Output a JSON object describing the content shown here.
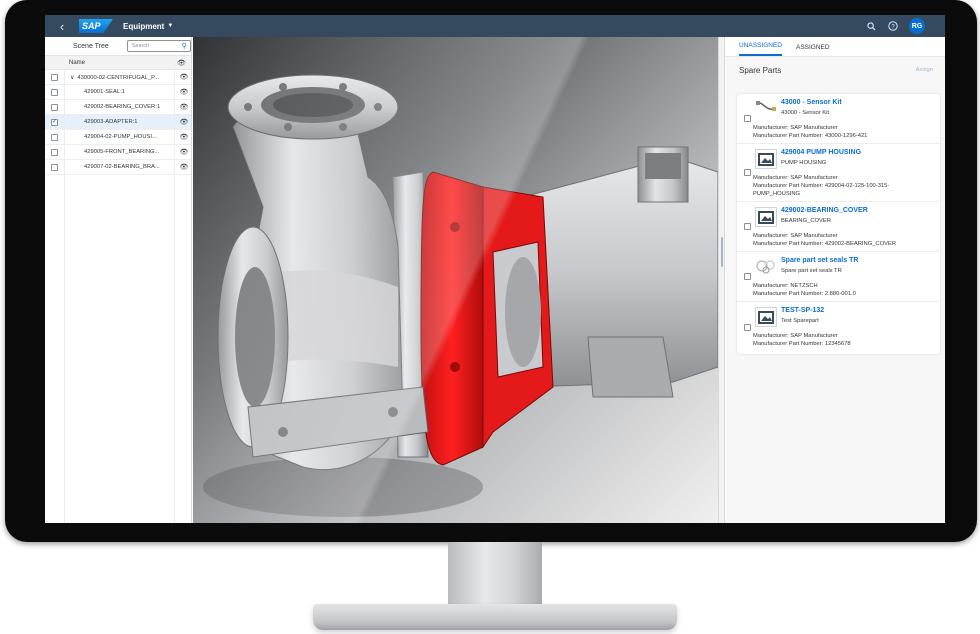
{
  "shell": {
    "back_icon": "chevron-left-icon",
    "logo_text": "SAP",
    "app_title": "Equipment",
    "search_icon": "search-icon",
    "help_icon": "help-icon",
    "avatar_initials": "RG",
    "colors": {
      "shell_bg": "#354a5f",
      "accent": "#0a6ed1",
      "highlight": "#e01b1b"
    }
  },
  "scene_tree": {
    "title": "Scene Tree",
    "search_placeholder": "Search",
    "column_name": "Name",
    "rows": [
      {
        "label": "430000-02-CENTRIFUGAL_P...",
        "checked": false,
        "selected": false,
        "expanded": true,
        "level": 0
      },
      {
        "label": "429001-SEAL:1",
        "checked": false,
        "selected": false,
        "level": 1
      },
      {
        "label": "429002-BEARING_COVER:1",
        "checked": false,
        "selected": false,
        "level": 1
      },
      {
        "label": "429003-ADAPTER:1",
        "checked": true,
        "selected": true,
        "level": 1
      },
      {
        "label": "429004-02-PUMP_HOUSI...",
        "checked": false,
        "selected": false,
        "level": 1
      },
      {
        "label": "429005-FRONT_BEARING...",
        "checked": false,
        "selected": false,
        "level": 1
      },
      {
        "label": "429007-02-BEARING_BRA...",
        "checked": false,
        "selected": false,
        "level": 1
      }
    ]
  },
  "right_panel": {
    "tabs": [
      {
        "label": "UNASSIGNED",
        "active": true
      },
      {
        "label": "ASSIGNED",
        "active": false
      }
    ],
    "section_title": "Spare Parts",
    "assign_label": "Assign",
    "spare_parts": [
      {
        "title": "43000 - Sensor Kit",
        "description": "43000 - Sensor Kit",
        "thumbnail": "cable-icon",
        "meta": [
          "Manufacturer: SAP Manufacturer",
          "Manufacturer Part Number: 43000-1296-421"
        ]
      },
      {
        "title": "429004 PUMP HOUSING",
        "description": "PUMP HOUSING",
        "thumbnail": "image-placeholder-icon",
        "meta": [
          "Manufacturer: SAP Manufacturer",
          "Manufacturer Part Number: 429004-02-125-100-315-",
          "PUMP_HOUSING"
        ]
      },
      {
        "title": "429002-BEARING_COVER",
        "description": "BEARING_COVER",
        "thumbnail": "image-placeholder-icon",
        "meta": [
          "Manufacturer: SAP Manufacturer",
          "Manufacturer Part Number: 429002-BEARING_COVER"
        ]
      },
      {
        "title": "Spare part set seals TR",
        "description": "Spare part set seals TR",
        "thumbnail": "seal-kit-icon",
        "meta": [
          "Manufacturer: NETZSCH",
          "Manufacturer Part Number: 2.880-001.0"
        ]
      },
      {
        "title": "TEST-SP-132",
        "description": "Test Sparepart",
        "thumbnail": "image-placeholder-icon",
        "meta": [
          "Manufacturer: SAP Manufacturer",
          "Manufacturer Part Number: 12345678"
        ]
      }
    ]
  }
}
